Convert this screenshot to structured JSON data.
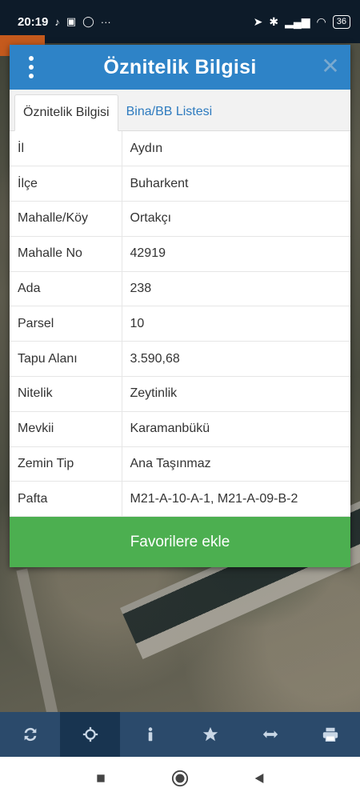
{
  "status_bar": {
    "time": "20:19",
    "more": "···",
    "battery": "36"
  },
  "dialog": {
    "title": "Öznitelik Bilgisi",
    "tabs": [
      {
        "label": "Öznitelik Bilgisi",
        "active": true
      },
      {
        "label": "Bina/BB Listesi",
        "active": false
      }
    ],
    "rows": [
      {
        "key": "İl",
        "value": "Aydın"
      },
      {
        "key": "İlçe",
        "value": "Buharkent"
      },
      {
        "key": "Mahalle/Köy",
        "value": "Ortakçı"
      },
      {
        "key": "Mahalle No",
        "value": "42919"
      },
      {
        "key": "Ada",
        "value": "238"
      },
      {
        "key": "Parsel",
        "value": "10"
      },
      {
        "key": "Tapu Alanı",
        "value": "3.590,68"
      },
      {
        "key": "Nitelik",
        "value": "Zeytinlik"
      },
      {
        "key": "Mevkii",
        "value": "Karamanbükü"
      },
      {
        "key": "Zemin Tip",
        "value": "Ana Taşınmaz"
      },
      {
        "key": "Pafta",
        "value": "M21-A-10-A-1, M21-A-09-B-2"
      }
    ],
    "favorite_button": "Favorilere ekle"
  },
  "toolbar": {
    "items": [
      {
        "icon": "refresh-icon",
        "active": false
      },
      {
        "icon": "crosshair-icon",
        "active": true
      },
      {
        "icon": "info-icon",
        "active": false
      },
      {
        "icon": "star-icon",
        "active": false
      },
      {
        "icon": "measure-icon",
        "active": false
      },
      {
        "icon": "print-icon",
        "active": false
      }
    ]
  },
  "colors": {
    "header": "#2e83c7",
    "favorite_button": "#4caf50",
    "toolbar": "#2b4a6b"
  }
}
